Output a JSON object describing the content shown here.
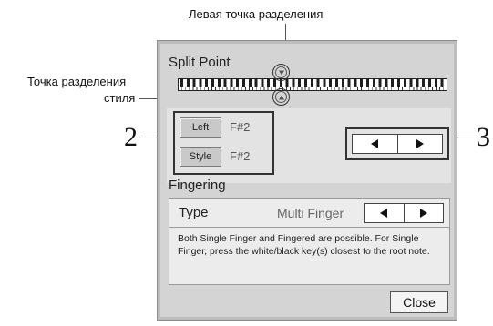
{
  "annotations": {
    "left_split": "Левая точка разделения",
    "style_split_line1": "Точка разделения",
    "style_split_line2": "стиля",
    "num_left": "2",
    "num_right": "3"
  },
  "split_point": {
    "title": "Split Point",
    "left_button": "Left",
    "left_value": "F#2",
    "style_button": "Style",
    "style_value": "F#2"
  },
  "fingering": {
    "title": "Fingering",
    "type_label": "Type",
    "type_value": "Multi Finger",
    "description": "Both Single Finger and Fingered are possible. For Single Finger, press the white/black key(s) closest to the root note."
  },
  "close_label": "Close",
  "icons": [
    "marker-down-icon",
    "marker-up-icon",
    "arrow-left-icon",
    "arrow-right-icon",
    "keyboard-icon"
  ]
}
